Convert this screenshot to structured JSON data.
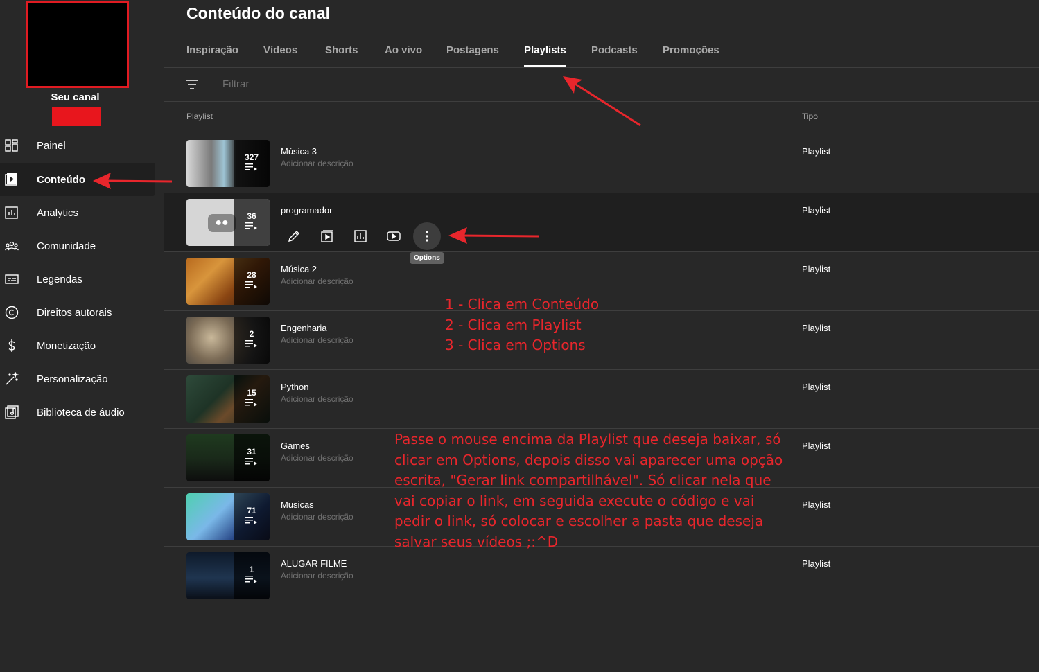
{
  "sidebar": {
    "channel_label": "Seu canal",
    "items": [
      {
        "label": "Painel",
        "icon": "dashboard-icon"
      },
      {
        "label": "Conteúdo",
        "icon": "content-icon"
      },
      {
        "label": "Analytics",
        "icon": "analytics-icon"
      },
      {
        "label": "Comunidade",
        "icon": "community-icon"
      },
      {
        "label": "Legendas",
        "icon": "subtitles-icon"
      },
      {
        "label": "Direitos autorais",
        "icon": "copyright-icon"
      },
      {
        "label": "Monetização",
        "icon": "dollar-icon"
      },
      {
        "label": "Personalização",
        "icon": "magic-wand-icon"
      },
      {
        "label": "Biblioteca de áudio",
        "icon": "audio-library-icon"
      }
    ],
    "active_index": 1
  },
  "page": {
    "title": "Conteúdo do canal",
    "tabs": [
      "Inspiração",
      "Vídeos",
      "Shorts",
      "Ao vivo",
      "Postagens",
      "Playlists",
      "Podcasts",
      "Promoções"
    ],
    "active_tab": "Playlists",
    "filter_placeholder": "Filtrar",
    "columns": {
      "playlist": "Playlist",
      "type": "Tipo"
    }
  },
  "playlists": [
    {
      "title": "Música 3",
      "description": "Adicionar descrição",
      "count": "327",
      "type": "Playlist"
    },
    {
      "title": "programador",
      "description": "",
      "count": "36",
      "type": "Playlist"
    },
    {
      "title": "Música 2",
      "description": "Adicionar descrição",
      "count": "28",
      "type": "Playlist"
    },
    {
      "title": "Engenharia",
      "description": "Adicionar descrição",
      "count": "2",
      "type": "Playlist"
    },
    {
      "title": "Python",
      "description": "Adicionar descrição",
      "count": "15",
      "type": "Playlist"
    },
    {
      "title": "Games",
      "description": "Adicionar descrição",
      "count": "31",
      "type": "Playlist"
    },
    {
      "title": "Musicas",
      "description": "Adicionar descrição",
      "count": "71",
      "type": "Playlist"
    },
    {
      "title": "ALUGAR FILME",
      "description": "Adicionar descrição",
      "count": "1",
      "type": "Playlist"
    }
  ],
  "hover_actions": [
    "edit-pencil-icon",
    "content-icon",
    "analytics-icon",
    "youtube-play-icon",
    "more-vert-icon"
  ],
  "tooltip": "Options",
  "annotations": {
    "steps": [
      "1 - Clica em Conteúdo",
      "2 - Clica em Playlist",
      "3 - Clica em Options"
    ],
    "note_lines": [
      "Passe o mouse encima da Playlist que deseja baixar, só",
      "clicar em Options, depois disso vai aparecer uma opção",
      "escrita, \"Gerar link compartilhável\". Só clicar nela que",
      "vai copiar o link, em seguida execute o código e vai",
      "pedir o link, só colocar e escolher a pasta que deseja",
      "salvar seus vídeos ;:^D"
    ]
  },
  "colors": {
    "background": "#282828",
    "accent_red": "#e8262c",
    "hover_row": "#1f1f1f"
  }
}
